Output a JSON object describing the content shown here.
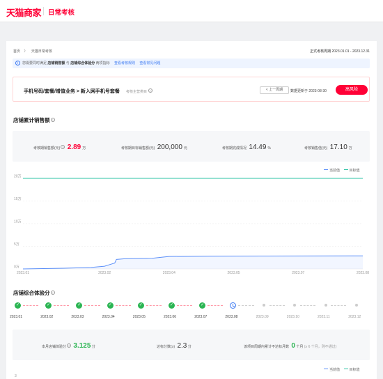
{
  "header": {
    "logo": "天猫商家",
    "title": "日常考核"
  },
  "breadcrumb": {
    "home": "首页",
    "sep": "〉",
    "current": "天猫日常考核"
  },
  "period": "正式考核周期 2023.01.01 - 2023.12.31",
  "notice": {
    "pre": "您需要同时满足 ",
    "b1": "店铺销售额",
    "mid": " 与 ",
    "b2": "店铺综合体验分",
    "post": " 两项指标",
    "link1": "查看考核规则",
    "link2": "查看常见问题"
  },
  "category": {
    "name": "手机号码/套餐/增值业务 > 新入网手机号套餐",
    "sub": "考核主营类目",
    "prev_button": "< 上一周期",
    "updated": "数据更新于 2023-08-30",
    "risk_button": "高风险"
  },
  "sales": {
    "title": "店铺累计销售额",
    "stats": [
      {
        "label": "考核期销售额(元)",
        "value": "2.89",
        "unit": "万"
      },
      {
        "label": "考核期目标销售额(元)",
        "value": "200,000",
        "unit": "元"
      },
      {
        "label": "考核期完成情况",
        "value": "14.49",
        "unit": "%"
      },
      {
        "label": "考核销售值(元)",
        "value": "17.10",
        "unit": "万"
      }
    ]
  },
  "legend": {
    "current": "当前值",
    "target": "目标值"
  },
  "colors": {
    "current": "#5b8ff9",
    "target": "#2bc3a4",
    "risk": "#ff0036",
    "ok": "#2cb553"
  },
  "chart_data": {
    "type": "line",
    "y_ticks": [
      "20万",
      "15万",
      "10万",
      "5万",
      "0万"
    ],
    "x_ticks": [
      "2023.01",
      "2023.02",
      "2023.04",
      "2023.05",
      "2023.07",
      "2023.08"
    ],
    "ylim": [
      0,
      200000
    ],
    "series": [
      {
        "name": "当前值",
        "points": [
          [
            0,
            0
          ],
          [
            0.12,
            1500
          ],
          [
            0.2,
            3200
          ],
          [
            0.24,
            6000
          ],
          [
            0.255,
            9500
          ],
          [
            0.27,
            13000
          ],
          [
            0.275,
            21000
          ],
          [
            0.3,
            22500
          ],
          [
            0.38,
            23500
          ],
          [
            0.41,
            26000
          ],
          [
            0.43,
            27500
          ],
          [
            0.55,
            28000
          ],
          [
            0.7,
            28500
          ],
          [
            1,
            28900
          ]
        ]
      },
      {
        "name": "目标值",
        "points": [
          [
            0,
            200000
          ],
          [
            1,
            200000
          ]
        ]
      }
    ]
  },
  "experience": {
    "title": "店铺综合体验分",
    "months": [
      {
        "label": "2023.01",
        "state": "done"
      },
      {
        "label": "2023.02",
        "state": "done"
      },
      {
        "label": "2023.03",
        "state": "done"
      },
      {
        "label": "2023.04",
        "state": "done"
      },
      {
        "label": "2023.05",
        "state": "done"
      },
      {
        "label": "2023.06",
        "state": "done"
      },
      {
        "label": "2023.07",
        "state": "done"
      },
      {
        "label": "2023.08",
        "state": "current"
      },
      {
        "label": "2023.09",
        "state": "future"
      },
      {
        "label": "2023.10",
        "state": "future"
      },
      {
        "label": "2023.11",
        "state": "future"
      },
      {
        "label": "2023.12",
        "state": "future"
      }
    ],
    "score_label": "本月店铺体验分",
    "score": "3.125",
    "score_unit": "分",
    "pass_label": "达标分数(≥)",
    "pass_value": "2.3",
    "pass_unit": "分",
    "fail_label": "该项目周期内累计不达标月数",
    "fail_value": "0",
    "fail_unit": "个月",
    "fail_note": "(≥ 6 个月，则不通过)",
    "bottom_tick": "3"
  }
}
